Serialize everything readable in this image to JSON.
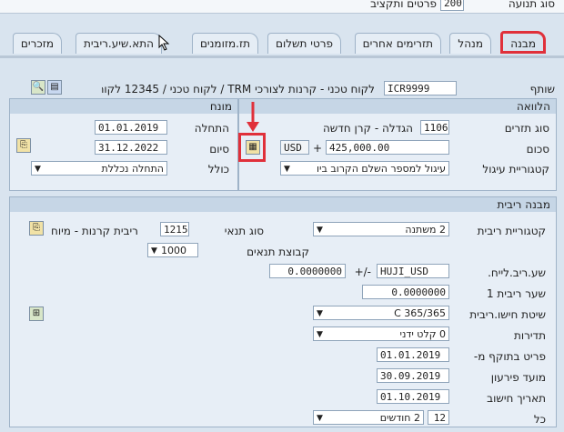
{
  "top": {
    "label": "סוג תנועה",
    "value": "200",
    "value_text": "פרטים ותקציב",
    "right_label": "סוג תנועה"
  },
  "tabs": [
    "מבנה",
    "מנהל",
    "תזרימים אחרים",
    "פרטי תשלום",
    "תז.מזומנים",
    "התא.שיע.ריבית",
    "מזכרים"
  ],
  "partner": {
    "label": "שותף",
    "value": "ICR9999",
    "desc": "לקוח טכני - קרנות לצורכי TRM / לקוח טכני / 12345 לקוח טכני"
  },
  "loan": {
    "title": "הלוואה",
    "flow_type_label": "סוג תזרים",
    "flow_type_code": "1106",
    "flow_type_text": "הגדלה - קרן חדשה",
    "amount_label": "סכום",
    "amount_value": "425,000.00",
    "currency": "USD",
    "sign": "+",
    "rounding_label": "קטגוריית עיגול",
    "rounding_value": "עיגול למספר השלם הקרוב ביו"
  },
  "term": {
    "title": "מונח",
    "start_label": "התחלה",
    "start_value": "01.01.2019",
    "end_label": "סיום",
    "end_value": "31.12.2022",
    "incl_label": "כולל",
    "incl_value": "התחלה נכללת"
  },
  "interest": {
    "title": "מבנה ריבית",
    "category_label": "קטגוריית ריבית",
    "category_value": "2 משתנה",
    "cond_label": "סוג תנאי",
    "cond_code": "1215",
    "cond_text": "ריבית קרנות - מיוח",
    "group_label": "קבוצת תנאים",
    "group_value": "1000",
    "ref_label": "שע.ריב.לייח.",
    "ref_value": "HUJI_USD",
    "ref_sign": "-/+",
    "ref_spread": "0.0000000",
    "rate1_label": "שער ריבית 1",
    "rate1_value": "0.0000000",
    "calc_label": "שיטת חישו.ריבית",
    "calc_value": "C 365/365",
    "freq_label": "תדירות",
    "freq_value": "0 קלט ידני",
    "eff_label": "פריט בתוקף מ-",
    "eff_value": "01.01.2019",
    "due_label": "מועד פירעון",
    "due_value": "30.09.2019",
    "calcdate_label": "תאריך חישוב",
    "calcdate_value": "01.10.2019",
    "every_label": "כל",
    "every_num": "12",
    "every_unit": "2 חודשים"
  }
}
